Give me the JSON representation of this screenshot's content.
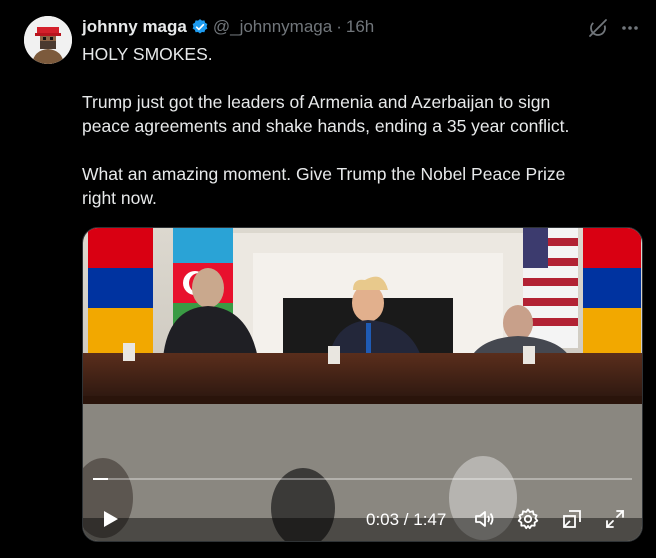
{
  "post": {
    "author_name": "johnny maga",
    "handle": "@_johnnymaga",
    "separator": "·",
    "time": "16h",
    "paragraphs": [
      "HOLY SMOKES.",
      "Trump just got the leaders of Armenia and Azerbaijan to sign\npeace agreements and shake hands, ending a 35 year conflict.",
      "What an amazing moment. Give Trump the Nobel Peace Prize\nright now."
    ]
  },
  "video": {
    "timecode": "0:03 / 1:47",
    "progress": 0.028
  },
  "colors": {
    "accent": "#1d9bf0",
    "muted": "#71767b",
    "text": "#e7e9ea",
    "bg": "#000000"
  },
  "icons": [
    "verified-badge-icon",
    "grok-icon",
    "more-icon",
    "play-icon",
    "volume-icon",
    "settings-icon",
    "pip-icon",
    "fullscreen-icon"
  ]
}
